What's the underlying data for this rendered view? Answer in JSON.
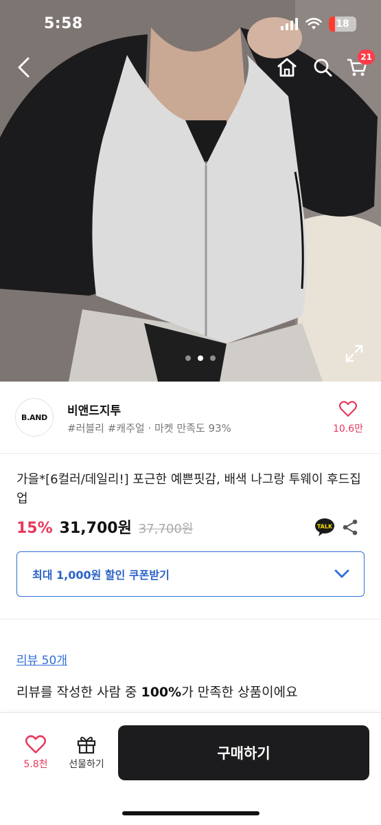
{
  "status_bar": {
    "time": "5:58",
    "battery": "18"
  },
  "nav": {
    "cart_count": "21"
  },
  "gallery": {
    "dots_total": 3,
    "active_dot": 1
  },
  "store": {
    "logo_text": "B.AND",
    "name": "비앤드지투",
    "tags": "#러블리 #캐주얼 · 마켓 만족도 93%",
    "likes": "10.6만"
  },
  "product": {
    "title": "가을*[6컬러/데일리!] 포근한 예쁜핏감, 배색 나그랑 투웨이 후드집업",
    "discount": "15%",
    "price": "31,700원",
    "original_price": "37,700원",
    "talk_label": "TALK"
  },
  "coupon": {
    "label": "최대 1,000원 할인 쿠폰받기"
  },
  "reviews": {
    "link": "리뷰 50개",
    "summary_prefix": "리뷰를 작성한 사람 중 ",
    "summary_bold": "100%",
    "summary_suffix": "가 만족한 상품이에요"
  },
  "bottom_bar": {
    "wish_count": "5.8천",
    "gift_label": "선물하기",
    "buy_label": "구매하기"
  },
  "colors": {
    "accent_pink": "#e8385c",
    "accent_blue": "#2f6fd8",
    "buy_button": "#1c1c1e",
    "cart_badge": "#ff3b47"
  }
}
